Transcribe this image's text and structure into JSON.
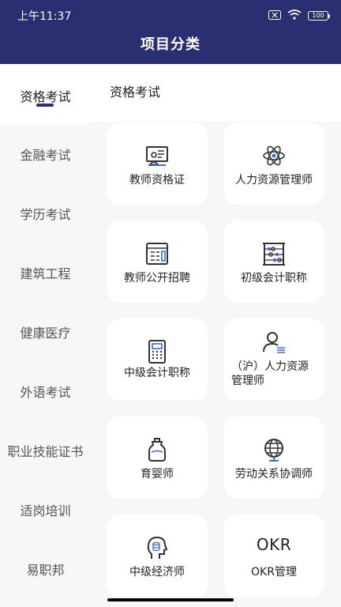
{
  "status": {
    "time": "上午11:37",
    "battery": "100"
  },
  "header": {
    "title": "项目分类"
  },
  "sidebar": {
    "items": [
      {
        "label": "资格考试",
        "active": true
      },
      {
        "label": "金融考试"
      },
      {
        "label": "学历考试"
      },
      {
        "label": "建筑工程"
      },
      {
        "label": "健康医疗"
      },
      {
        "label": "外语考试"
      },
      {
        "label": "职业技能证书"
      },
      {
        "label": "适岗培训"
      },
      {
        "label": "易职邦"
      }
    ]
  },
  "content": {
    "section_title": "资格考试",
    "cards": [
      {
        "label": "教师资格证",
        "icon": "teacher-certificate-icon"
      },
      {
        "label": "人力资源管理师",
        "icon": "atom-icon"
      },
      {
        "label": "教师公开招聘",
        "icon": "calendar-form-icon"
      },
      {
        "label": "初级会计职称",
        "icon": "abacus-icon"
      },
      {
        "label": "中级会计职称",
        "icon": "calculator-icon"
      },
      {
        "label": "（沪）人力资源管理师",
        "icon": "user-list-icon"
      },
      {
        "label": "育婴师",
        "icon": "baby-bottle-icon"
      },
      {
        "label": "劳动关系协调师",
        "icon": "globe-icon"
      },
      {
        "label": "中级经济师",
        "icon": "head-coins-icon"
      },
      {
        "label": "OKR管理",
        "icon": "okr-icon",
        "logo_text": "OKR"
      }
    ]
  },
  "colors": {
    "brand": "#2a2f72",
    "sidebar_bg": "#f7f7f8"
  }
}
